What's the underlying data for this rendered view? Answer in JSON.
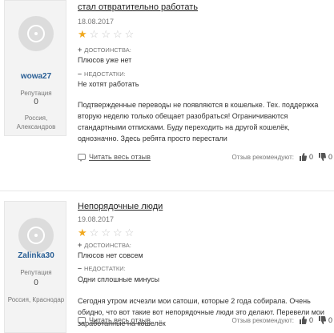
{
  "reviews": [
    {
      "title": "стал отвратительно работать",
      "date": "18.08.2017",
      "rating": 1,
      "max_rating": 5,
      "user": {
        "name": "wowa27",
        "reputation_label": "Репутация",
        "reputation": "0",
        "location": "Россия, Александров"
      },
      "pros_label": "ДОСТОИНСТВА:",
      "pros_text": "Плюсов уже нет",
      "cons_label": "НЕДОСТАТКИ:",
      "cons_text": "Не хотят работать",
      "body": "Подтвержденные переводы не появляются в кошельке. Тех. поддержка вторую неделю только обещает разобраться! Ограничиваются стандартными отписками. Буду переходить на другой кошелёк, однозначно. Здесь ребята просто перестали",
      "read_all": "Читать весь отзыв",
      "recommend_label": "Отзыв рекомендуют:",
      "likes": "0",
      "dislikes": "0"
    },
    {
      "title": "Непорядочные люди",
      "date": "19.08.2017",
      "rating": 1,
      "max_rating": 5,
      "user": {
        "name": "Zalinka30",
        "reputation_label": "Репутация",
        "reputation": "0",
        "location": "Россия, Краснодар"
      },
      "pros_label": "ДОСТОИНСТВА:",
      "pros_text": "Плюсов нет совсем",
      "cons_label": "НЕДОСТАТКИ:",
      "cons_text": "Одни сплошные минусы",
      "body": "Сегодня утром исчезли мои сатоши, которые 2 года собирала. Очень обидно, что вот такие вот непорядочные люди это делают. Перевели мои заработанные на кошелёк",
      "read_all": "Читать весь отзыв",
      "recommend_label": "Отзыв рекомендуют:",
      "likes": "0",
      "dislikes": "0"
    }
  ],
  "colors": {
    "username": "#2a5f95",
    "star_filled": "#f0a81e",
    "star_empty": "#c9c9c9"
  }
}
